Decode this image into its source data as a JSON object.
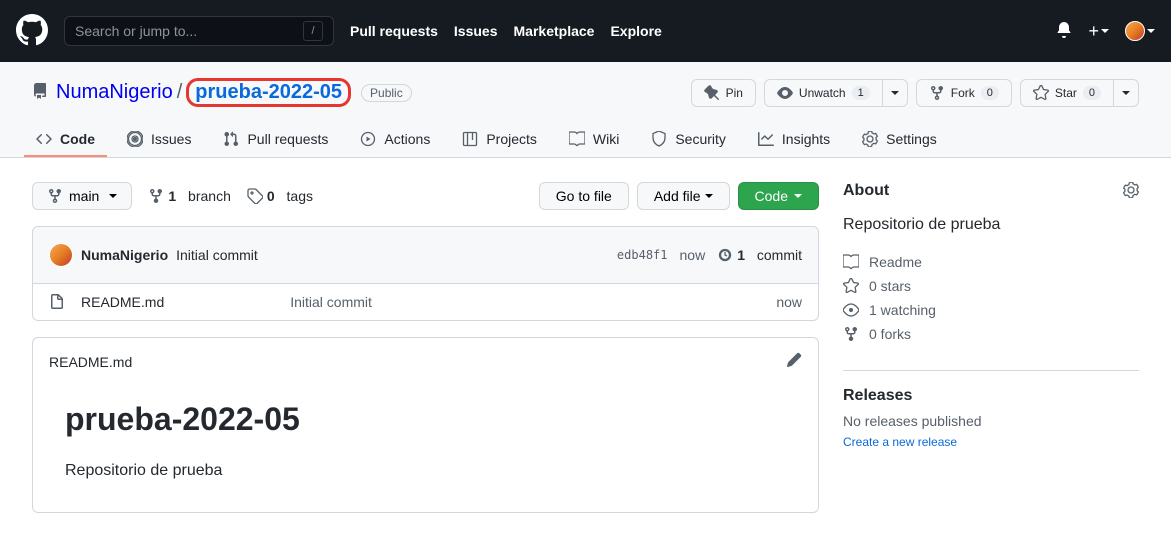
{
  "header": {
    "search_placeholder": "Search or jump to...",
    "nav": [
      "Pull requests",
      "Issues",
      "Marketplace",
      "Explore"
    ]
  },
  "repo": {
    "owner": "NumaNigerio",
    "name": "prueba-2022-05",
    "visibility": "Public"
  },
  "actions": {
    "pin": "Pin",
    "unwatch": "Unwatch",
    "unwatch_count": "1",
    "fork": "Fork",
    "fork_count": "0",
    "star": "Star",
    "star_count": "0"
  },
  "tabs": [
    "Code",
    "Issues",
    "Pull requests",
    "Actions",
    "Projects",
    "Wiki",
    "Security",
    "Insights",
    "Settings"
  ],
  "branch": {
    "current": "main",
    "branches_count": "1",
    "branches_label": "branch",
    "tags_count": "0",
    "tags_label": "tags"
  },
  "file_actions": {
    "goto": "Go to file",
    "add": "Add file",
    "code": "Code"
  },
  "commit": {
    "author": "NumaNigerio",
    "message": "Initial commit",
    "sha": "edb48f1",
    "time": "now",
    "count": "1",
    "count_label": "commit"
  },
  "files": [
    {
      "name": "README.md",
      "message": "Initial commit",
      "time": "now"
    }
  ],
  "readme": {
    "filename": "README.md",
    "title": "prueba-2022-05",
    "description": "Repositorio de prueba"
  },
  "about": {
    "heading": "About",
    "description": "Repositorio de prueba",
    "items": {
      "readme": "Readme",
      "stars": "0 stars",
      "watching": "1 watching",
      "forks": "0 forks"
    }
  },
  "releases": {
    "heading": "Releases",
    "none": "No releases published",
    "create": "Create a new release"
  }
}
